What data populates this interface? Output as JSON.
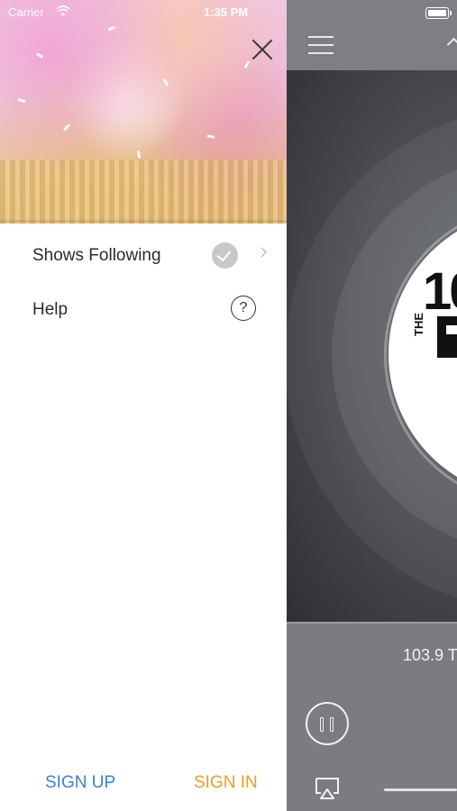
{
  "status_bar": {
    "carrier": "Carrier",
    "time": "1:35 PM"
  },
  "drawer": {
    "menu": [
      {
        "label": "Shows Following",
        "icon": "check-circle-icon",
        "trailing_icon": "chevron-right-icon"
      },
      {
        "label": "Help",
        "icon": "question-circle-icon"
      }
    ],
    "sign_up_label": "SIGN UP",
    "sign_in_label": "SIGN IN",
    "colors": {
      "sign_up": "#3a82cf",
      "sign_in": "#ee9d24"
    }
  },
  "player": {
    "logo_number": "10",
    "logo_the": "THE",
    "station_label": "103.9 T"
  }
}
